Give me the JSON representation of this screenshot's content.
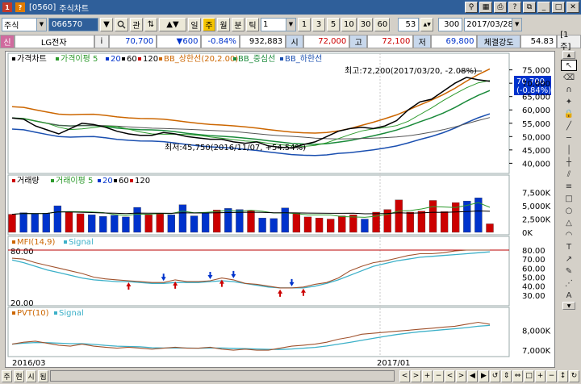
{
  "window": {
    "code": "[0560]",
    "title": "주식차트"
  },
  "toolbar": {
    "market": "주식",
    "stock_code": "066570",
    "search_icon": "search-icon",
    "btn_kwan": "관",
    "period_buttons": [
      "일",
      "주",
      "월",
      "분",
      "틱"
    ],
    "period_active": "주",
    "interval_value": "1",
    "interval_buttons": [
      "1",
      "3",
      "5",
      "10",
      "30",
      "60"
    ],
    "count_value": "53",
    "count_total": "300",
    "date_value": "2017/03/28"
  },
  "quote": {
    "badge": "신",
    "name": "LG전자",
    "info_btn": "i",
    "price": "70,700",
    "change": "▼600",
    "change_pct": "-0.84%",
    "volume": "932,883",
    "open_label": "시",
    "open": "72,000",
    "high_label": "고",
    "high": "72,100",
    "low_label": "저",
    "low": "69,800",
    "strength_label": "체결강도",
    "strength": "54.83",
    "unit_btn": "[1주]"
  },
  "colors": {
    "up": "#cc0000",
    "down": "#0033cc",
    "ma5": "#2c9a2c",
    "ma20": "#0033cc",
    "ma60": "#000000",
    "ma120": "#cc0000",
    "bb_upper": "#cc6600",
    "bb_mid": "#1a8a3a",
    "bb_lower": "#1a4fb0",
    "signal": "#3cb0c8"
  },
  "price_panel": {
    "legend": [
      "가격차트",
      "가격이평 5",
      "20",
      "60",
      "120",
      "BB_상한선(20,2.00)",
      "BB_중심선",
      "BB_하한선"
    ],
    "max_annot": "최고:72,200(2017/03/20, -2.08%)",
    "min_annot": "최저:45,750(2016/11/07, +54.54%)",
    "current_price": "70,700",
    "current_pct": "(-0.84%)",
    "y_ticks": [
      "75,000",
      "70,000",
      "65,000",
      "60,000",
      "55,000",
      "50,000",
      "45,000",
      "40,000"
    ]
  },
  "volume_panel": {
    "legend": [
      "거래량",
      "거래이평 5",
      "20",
      "60",
      "120"
    ],
    "y_ticks": [
      "7,500K",
      "5,000K",
      "2,500K",
      "0K"
    ]
  },
  "mfi_panel": {
    "legend": [
      "MFI(14,9)",
      "Signal"
    ],
    "left_top": "80.00",
    "left_bottom": "20.00",
    "y_ticks": [
      "80.00",
      "70.00",
      "60.00",
      "50.00",
      "40.00",
      "30.00"
    ]
  },
  "pvt_panel": {
    "legend": [
      "PVT(10)",
      "Signal"
    ],
    "y_ticks": [
      "8,000K",
      "7,000K"
    ]
  },
  "x_axis": {
    "left_label": "2016/03",
    "mid_label": "2017/01"
  },
  "right_tools": [
    "cursor-icon",
    "eraser-icon",
    "magnet-icon",
    "star-icon",
    "lock-icon",
    "trend-line-icon",
    "horizontal-line-icon",
    "vertical-line-icon",
    "cross-line-icon",
    "channel-icon",
    "fibonacci-icon",
    "rect-icon",
    "ellipse-icon",
    "triangle-icon",
    "arc-icon",
    "text-icon",
    "arrow-icon",
    "pen-icon",
    "gann-icon",
    "auto-icon",
    "scroll-down-icon"
  ],
  "statusbar": {
    "left_buttons": [
      "주",
      "현",
      "시",
      "됨"
    ],
    "right_buttons": [
      "<",
      ">",
      "+",
      "−",
      "<",
      ">",
      "◀",
      "▶",
      "↺",
      "⇕",
      "⇔",
      "□",
      "+",
      "−",
      "↕",
      "↻"
    ]
  },
  "chart_data": {
    "type": "line",
    "x_labels": [
      "2016/03",
      "2017/01"
    ],
    "price": {
      "close": [
        57000,
        56500,
        54000,
        52500,
        51000,
        53000,
        55000,
        54500,
        53500,
        52000,
        51000,
        50500,
        50500,
        51500,
        51000,
        50000,
        49500,
        49000,
        49000,
        48000,
        47500,
        48000,
        46500,
        46000,
        45750,
        47000,
        48000,
        50000,
        52000,
        53000,
        53500,
        53000,
        54000,
        56000,
        60000,
        63000,
        64000,
        67000,
        70000,
        72200,
        71300,
        70700
      ]
    },
    "max": {
      "value": 72200,
      "date": "2017/03/20",
      "pct": -2.08
    },
    "min": {
      "value": 45750,
      "date": "2016/11/07",
      "pct": 54.54
    },
    "volume_k": [
      3400,
      3700,
      3500,
      3600,
      5000,
      3800,
      3500,
      3300,
      3000,
      3200,
      2900,
      4700,
      3300,
      3500,
      3300,
      5200,
      3100,
      3700,
      4200,
      4500,
      4300,
      4100,
      2700,
      2600,
      4600,
      3600,
      2900,
      2700,
      2500,
      3100,
      3300,
      2500,
      3800,
      4300,
      6100,
      3800,
      4000,
      6000,
      3900,
      5600,
      5900,
      6500,
      1600
    ],
    "mfi": [
      71,
      70,
      66,
      63,
      60,
      57,
      54,
      50,
      48,
      47,
      46,
      45,
      44,
      44,
      47,
      45,
      45,
      46,
      49,
      47,
      43,
      42,
      40,
      38,
      38,
      39,
      42,
      44,
      49,
      57,
      62,
      66,
      68,
      71,
      74,
      76,
      76,
      77,
      79,
      80,
      80,
      80
    ],
    "mfi_signal": [
      69,
      66,
      62,
      58,
      55,
      52,
      49,
      47,
      46,
      45,
      45,
      44,
      43,
      43,
      44,
      44,
      44,
      45,
      46,
      45,
      43,
      41,
      39,
      38,
      38,
      38,
      40,
      43,
      47,
      52,
      57,
      62,
      65,
      68,
      70,
      72,
      73,
      74,
      75,
      76,
      77,
      78
    ],
    "mfi_range": [
      20,
      80
    ],
    "pvt_k": [
      7300,
      7400,
      7450,
      7350,
      7250,
      7200,
      7300,
      7200,
      7150,
      7100,
      7150,
      7100,
      7050,
      7100,
      7150,
      7100,
      7100,
      7150,
      7050,
      7000,
      7050,
      7000,
      7000,
      7100,
      7200,
      7250,
      7300,
      7400,
      7550,
      7650,
      7800,
      7850,
      7900,
      7950,
      8000,
      8050,
      8100,
      8150,
      8200,
      8300,
      8400,
      8300
    ]
  }
}
